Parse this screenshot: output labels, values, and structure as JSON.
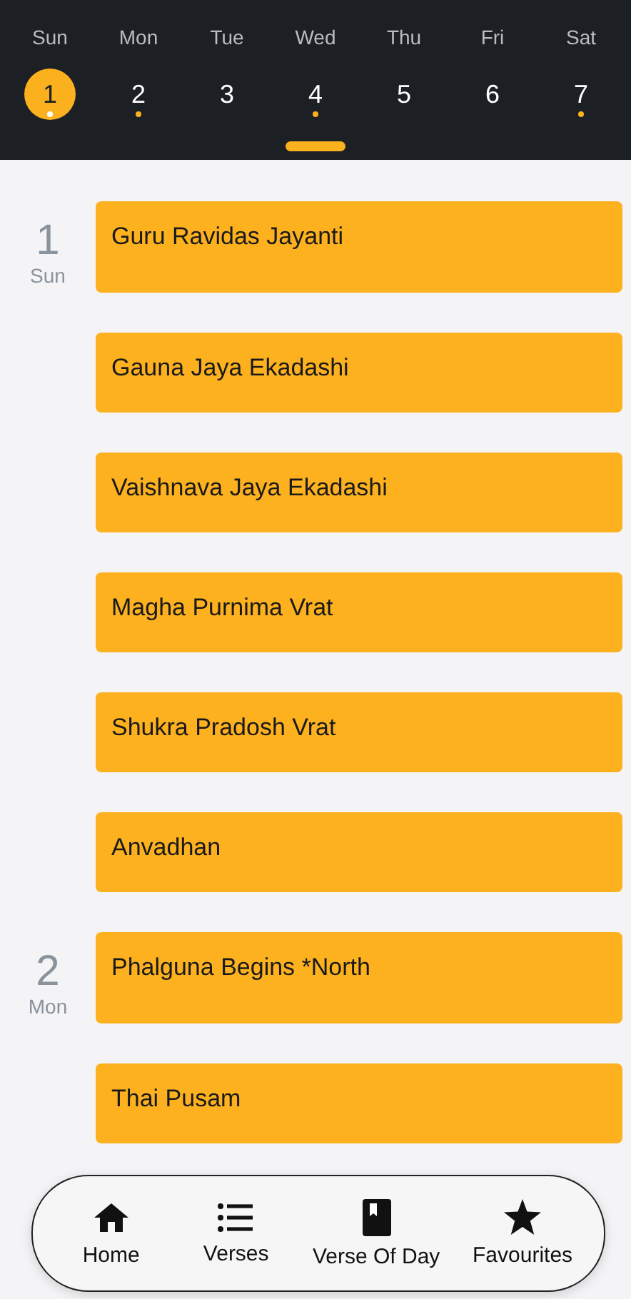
{
  "week": [
    {
      "weekday": "Sun",
      "date": "1",
      "selected": true,
      "has_event": true
    },
    {
      "weekday": "Mon",
      "date": "2",
      "selected": false,
      "has_event": true
    },
    {
      "weekday": "Tue",
      "date": "3",
      "selected": false,
      "has_event": false
    },
    {
      "weekday": "Wed",
      "date": "4",
      "selected": false,
      "has_event": true
    },
    {
      "weekday": "Thu",
      "date": "5",
      "selected": false,
      "has_event": false
    },
    {
      "weekday": "Fri",
      "date": "6",
      "selected": false,
      "has_event": false
    },
    {
      "weekday": "Sat",
      "date": "7",
      "selected": false,
      "has_event": true
    }
  ],
  "agenda": [
    {
      "date": "1",
      "weekday": "Sun",
      "events": [
        "Guru Ravidas Jayanti",
        "Gauna Jaya Ekadashi",
        "Vaishnava Jaya Ekadashi",
        "Magha Purnima Vrat",
        "Shukra Pradosh Vrat",
        "Anvadhan"
      ]
    },
    {
      "date": "2",
      "weekday": "Mon",
      "events": [
        "Phalguna Begins *North",
        "Thai Pusam"
      ]
    }
  ],
  "bottom_nav": [
    {
      "kind": "home",
      "label": "Home"
    },
    {
      "kind": "list",
      "label": "Verses"
    },
    {
      "kind": "book",
      "label": "Verse Of Day"
    },
    {
      "kind": "star",
      "label": "Favourites"
    }
  ]
}
